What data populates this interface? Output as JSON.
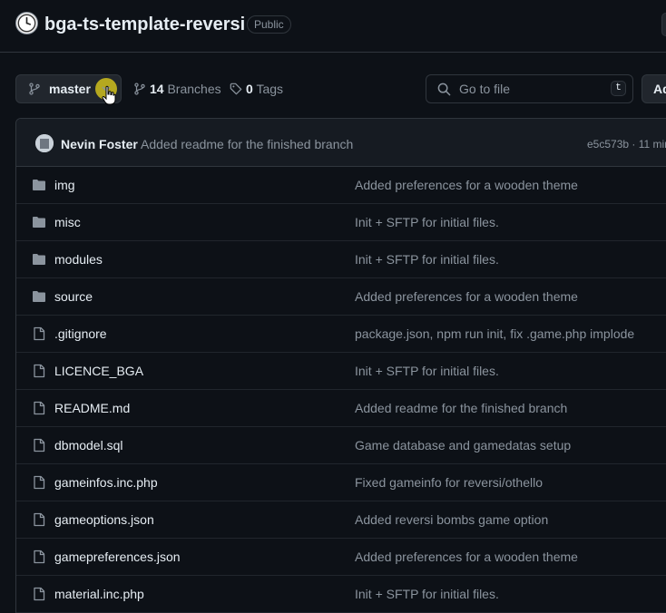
{
  "repo": {
    "name": "bga-ts-template-reversi",
    "visibility": "Public"
  },
  "toolbar": {
    "branch_name": "master",
    "branches_count": "14",
    "branches_label": "Branches",
    "tags_count": "0",
    "tags_label": "Tags",
    "go_to_file_placeholder": "Go to file",
    "go_to_file_shortcut": "t",
    "add_file_label": "Ad"
  },
  "latest_commit": {
    "author": "Nevin Foster",
    "message": "Added readme for the finished branch",
    "hash_time": "e5c573b · 11 min"
  },
  "files": [
    {
      "type": "folder",
      "icon": "folder-icon",
      "name": "img",
      "commit": "Added preferences for a wooden theme"
    },
    {
      "type": "folder",
      "icon": "folder-icon",
      "name": "misc",
      "commit": "Init + SFTP for initial files."
    },
    {
      "type": "folder",
      "icon": "folder-icon",
      "name": "modules",
      "commit": "Init + SFTP for initial files."
    },
    {
      "type": "folder",
      "icon": "folder-icon",
      "name": "source",
      "commit": "Added preferences for a wooden theme"
    },
    {
      "type": "file",
      "icon": "file-icon",
      "name": ".gitignore",
      "commit": "package.json, npm run init, fix .game.php implode"
    },
    {
      "type": "file",
      "icon": "file-icon",
      "name": "LICENCE_BGA",
      "commit": "Init + SFTP for initial files."
    },
    {
      "type": "file",
      "icon": "file-icon",
      "name": "README.md",
      "commit": "Added readme for the finished branch"
    },
    {
      "type": "file",
      "icon": "file-icon",
      "name": "dbmodel.sql",
      "commit": "Game database and gamedatas setup"
    },
    {
      "type": "file",
      "icon": "file-icon",
      "name": "gameinfos.inc.php",
      "commit": "Fixed gameinfo for reversi/othello"
    },
    {
      "type": "file",
      "icon": "file-icon",
      "name": "gameoptions.json",
      "commit": "Added reversi bombs game option"
    },
    {
      "type": "file",
      "icon": "file-icon",
      "name": "gamepreferences.json",
      "commit": "Added preferences for a wooden theme"
    },
    {
      "type": "file",
      "icon": "file-icon",
      "name": "material.inc.php",
      "commit": "Init + SFTP for initial files."
    }
  ],
  "colors": {
    "background": "#0d1117",
    "border": "#30363d",
    "muted_text": "#8b949e",
    "text": "#e6edf3",
    "cursor_highlight": "#b5a81f"
  }
}
